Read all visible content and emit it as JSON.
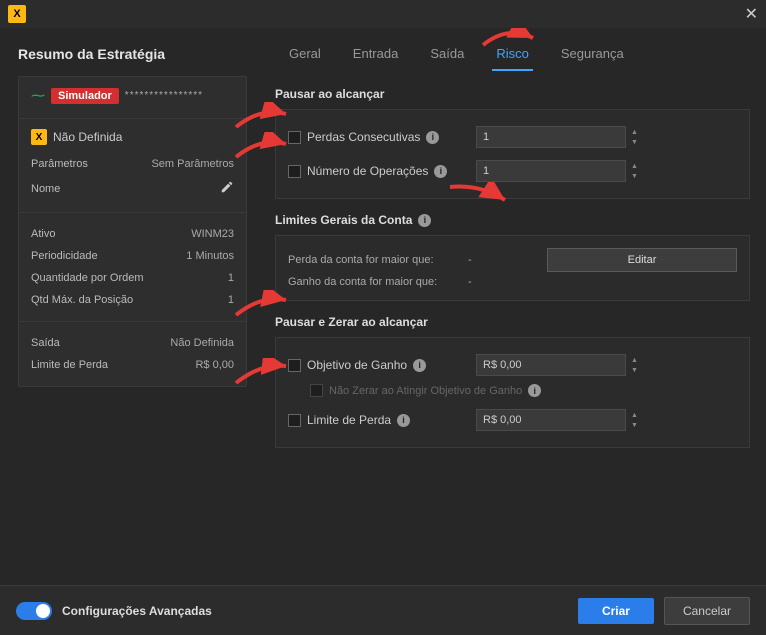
{
  "titlebar": {
    "logo_letter": "X"
  },
  "sidebar": {
    "title": "Resumo da Estratégia",
    "simulator_badge": "Simulador",
    "stars": "****************",
    "strategy_name": "Não Definida",
    "params_label": "Parâmetros",
    "params_value": "Sem Parâmetros",
    "name_label": "Nome",
    "rows": [
      {
        "label": "Ativo",
        "value": "WINM23"
      },
      {
        "label": "Periodicidade",
        "value": "1 Minutos"
      },
      {
        "label": "Quantidade por Ordem",
        "value": "1"
      },
      {
        "label": "Qtd Máx. da Posição",
        "value": "1"
      }
    ],
    "rows2": [
      {
        "label": "Saída",
        "value": "Não Definida"
      },
      {
        "label": "Limite de Perda",
        "value": "R$ 0,00"
      }
    ]
  },
  "tabs": {
    "t1": "Geral",
    "t2": "Entrada",
    "t3": "Saída",
    "t4": "Risco",
    "t5": "Segurança"
  },
  "risk": {
    "pause_reach_title": "Pausar ao alcançar",
    "consec_losses_label": "Perdas Consecutivas",
    "consec_losses_value": "1",
    "num_ops_label": "Número de Operações",
    "num_ops_value": "1",
    "account_limits_title": "Limites Gerais da Conta",
    "account_loss_label": "Perda da conta for maior que:",
    "account_gain_label": "Ganho da conta for maior que:",
    "account_loss_value": "-",
    "account_gain_value": "-",
    "edit_button": "Editar",
    "pause_zero_title": "Pausar e Zerar ao alcançar",
    "gain_target_label": "Objetivo de Ganho",
    "gain_target_value": "R$ 0,00",
    "no_zero_label": "Não Zerar ao Atingir Objetivo de Ganho",
    "loss_limit_label": "Limite de Perda",
    "loss_limit_value": "R$ 0,00"
  },
  "footer": {
    "toggle_label": "Configurações Avançadas",
    "create": "Criar",
    "cancel": "Cancelar"
  }
}
